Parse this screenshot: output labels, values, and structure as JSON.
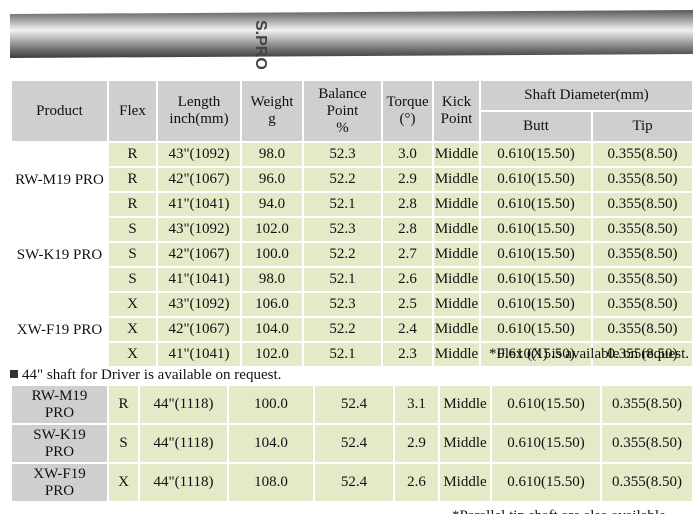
{
  "shaft_image": {
    "print": "S.PRO"
  },
  "headers": {
    "product": "Product",
    "flex": "Flex",
    "length_1": "Length",
    "length_2": "inch(mm)",
    "weight_1": "Weight",
    "weight_2": "g",
    "balance_1": "Balance",
    "balance_2": "Point",
    "balance_3": "%",
    "torque_1": "Torque",
    "torque_2": "(°)",
    "kick_1": "Kick",
    "kick_2": "Point",
    "diameter": "Shaft Diameter(mm)",
    "butt": "Butt",
    "tip": "Tip"
  },
  "groups": [
    {
      "product": "RW-M19 PRO",
      "rows": [
        {
          "flex": "R",
          "length": "43\"(1092)",
          "weight": "98.0",
          "balance": "52.3",
          "torque": "3.0",
          "kick": "Middle",
          "butt": "0.610(15.50)",
          "tip": "0.355(8.50)"
        },
        {
          "flex": "R",
          "length": "42\"(1067)",
          "weight": "96.0",
          "balance": "52.2",
          "torque": "2.9",
          "kick": "Middle",
          "butt": "0.610(15.50)",
          "tip": "0.355(8.50)"
        },
        {
          "flex": "R",
          "length": "41\"(1041)",
          "weight": "94.0",
          "balance": "52.1",
          "torque": "2.8",
          "kick": "Middle",
          "butt": "0.610(15.50)",
          "tip": "0.355(8.50)"
        }
      ]
    },
    {
      "product": "SW-K19 PRO",
      "rows": [
        {
          "flex": "S",
          "length": "43\"(1092)",
          "weight": "102.0",
          "balance": "52.3",
          "torque": "2.8",
          "kick": "Middle",
          "butt": "0.610(15.50)",
          "tip": "0.355(8.50)"
        },
        {
          "flex": "S",
          "length": "42\"(1067)",
          "weight": "100.0",
          "balance": "52.2",
          "torque": "2.7",
          "kick": "Middle",
          "butt": "0.610(15.50)",
          "tip": "0.355(8.50)"
        },
        {
          "flex": "S",
          "length": "41\"(1041)",
          "weight": "98.0",
          "balance": "52.1",
          "torque": "2.6",
          "kick": "Middle",
          "butt": "0.610(15.50)",
          "tip": "0.355(8.50)"
        }
      ]
    },
    {
      "product": "XW-F19 PRO",
      "rows": [
        {
          "flex": "X",
          "length": "43\"(1092)",
          "weight": "106.0",
          "balance": "52.3",
          "torque": "2.5",
          "kick": "Middle",
          "butt": "0.610(15.50)",
          "tip": "0.355(8.50)"
        },
        {
          "flex": "X",
          "length": "42\"(1067)",
          "weight": "104.0",
          "balance": "52.2",
          "torque": "2.4",
          "kick": "Middle",
          "butt": "0.610(15.50)",
          "tip": "0.355(8.50)"
        },
        {
          "flex": "X",
          "length": "41\"(1041)",
          "weight": "102.0",
          "balance": "52.1",
          "torque": "2.3",
          "kick": "Middle",
          "butt": "0.610(15.50)",
          "tip": "0.355(8.50)"
        }
      ]
    }
  ],
  "notes": {
    "flex_x": "*Flex (X) is available on request.",
    "driver": "44\" shaft for Driver is available on request.",
    "bottom": "*Parallel tip shaft are also available"
  },
  "driver_rows": [
    {
      "product_1": "RW-M19",
      "product_2": "PRO",
      "flex": "R",
      "length": "44\"(1118)",
      "weight": "100.0",
      "balance": "52.4",
      "torque": "3.1",
      "kick": "Middle",
      "butt": "0.610(15.50)",
      "tip": "0.355(8.50)"
    },
    {
      "product_1": "SW-K19",
      "product_2": "PRO",
      "flex": "S",
      "length": "44\"(1118)",
      "weight": "104.0",
      "balance": "52.4",
      "torque": "2.9",
      "kick": "Middle",
      "butt": "0.610(15.50)",
      "tip": "0.355(8.50)"
    },
    {
      "product_1": "XW-F19",
      "product_2": "PRO",
      "flex": "X",
      "length": "44\"(1118)",
      "weight": "108.0",
      "balance": "52.4",
      "torque": "2.6",
      "kick": "Middle",
      "butt": "0.610(15.50)",
      "tip": "0.355(8.50)"
    }
  ]
}
